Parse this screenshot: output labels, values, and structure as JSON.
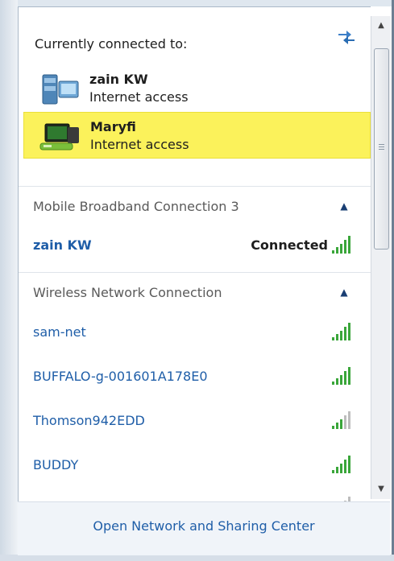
{
  "popup": {
    "header": "Currently connected to:",
    "connected": [
      {
        "name": "zain KW",
        "status": "Internet access",
        "icon": "broadband-computer-icon"
      },
      {
        "name": "Maryfi",
        "status": "Internet access",
        "icon": "wireless-network-icon",
        "highlighted": true
      }
    ],
    "groups": [
      {
        "label": "Mobile Broadband Connection 3",
        "networks": [
          {
            "name": "zain KW",
            "status": "Connected",
            "signal_bars": 5
          }
        ]
      },
      {
        "label": "Wireless Network Connection",
        "networks": [
          {
            "name": "sam-net",
            "signal_bars": 5
          },
          {
            "name": "BUFFALO-g-001601A178E0",
            "signal_bars": 5
          },
          {
            "name": "Thomson942EDD",
            "signal_bars": 3
          },
          {
            "name": "BUDDY",
            "signal_bars": 5
          }
        ]
      }
    ],
    "footer_link": "Open Network and Sharing Center"
  },
  "colors": {
    "highlight": "#fbf25b",
    "link": "#1f5ea8",
    "signal_on": "#3aa63a",
    "signal_off": "#bdbdbd"
  }
}
